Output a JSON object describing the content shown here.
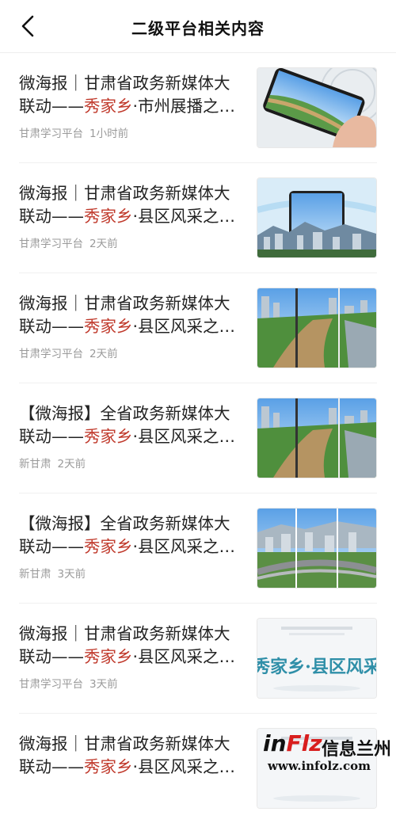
{
  "header": {
    "title": "二级平台相关内容"
  },
  "items": [
    {
      "line1": "微海报｜甘肃省政务新媒体大",
      "line2_prefix": "联动——",
      "line2_highlight": "秀家乡",
      "line2_suffix": "·市州展播之…",
      "source": "甘肃学习平台",
      "time": "1小时前",
      "thumb": "phone-river"
    },
    {
      "line1": "微海报｜甘肃省政务新媒体大",
      "line2_prefix": "联动——",
      "line2_highlight": "秀家乡",
      "line2_suffix": "·县区风采之…",
      "source": "甘肃学习平台",
      "time": "2天前",
      "thumb": "phone-city"
    },
    {
      "line1": "微海报｜甘肃省政务新媒体大",
      "line2_prefix": "联动——",
      "line2_highlight": "秀家乡",
      "line2_suffix": "·县区风采之…",
      "source": "甘肃学习平台",
      "time": "2天前",
      "thumb": "river-panels"
    },
    {
      "line1": "【微海报】全省政务新媒体大",
      "line2_prefix": "联动——",
      "line2_highlight": "秀家乡",
      "line2_suffix": "·县区风采之…",
      "source": "新甘肃",
      "time": "2天前",
      "thumb": "river-panels"
    },
    {
      "line1": "【微海报】全省政务新媒体大",
      "line2_prefix": "联动——",
      "line2_highlight": "秀家乡",
      "line2_suffix": "·县区风采之…",
      "source": "新甘肃",
      "time": "3天前",
      "thumb": "city-highway"
    },
    {
      "line1": "微海报｜甘肃省政务新媒体大",
      "line2_prefix": "联动——",
      "line2_highlight": "秀家乡",
      "line2_suffix": "·县区风采之…",
      "source": "甘肃学习平台",
      "time": "3天前",
      "thumb": "calligraphy"
    },
    {
      "line1": "微海报｜甘肃省政务新媒体大",
      "line2_prefix": "联动——",
      "line2_highlight": "秀家乡",
      "line2_suffix": "·县区风采之…",
      "source": "",
      "time": "",
      "thumb": "calligraphy-partial"
    }
  ],
  "thumb_calligraphy": {
    "main": "秀家乡·县区风采"
  },
  "watermark": {
    "logo_a": "in",
    "logo_b": "F",
    "logo_c": "lz",
    "cn": "信息兰州",
    "url": "www.infolz.com"
  },
  "colors": {
    "highlight": "#c0392b",
    "meta": "#9a9a9a",
    "title": "#111111"
  }
}
